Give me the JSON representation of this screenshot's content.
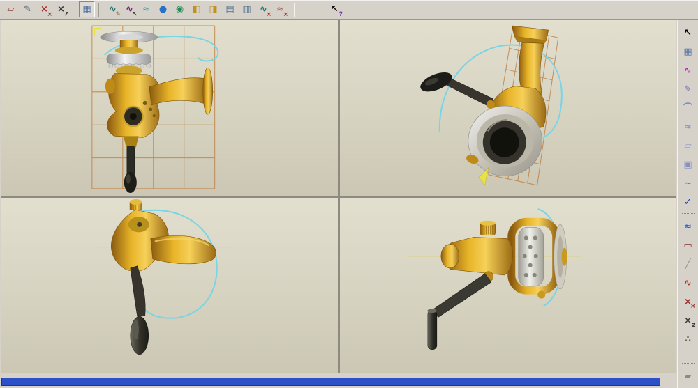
{
  "colors": {
    "toolbar_bg": "#d6d2ca",
    "viewport_top": "#e3dfcf",
    "viewport_bottom": "#cbc7b4",
    "grid_orange": "#bf7f3f",
    "style_curve_cyan": "#7ad4e4",
    "model_gold": "#e8b428",
    "statusbar_blue": "#2b50c8"
  },
  "top_toolbar": {
    "groups": [
      {
        "icons": [
          {
            "name": "datum-plane-sketch-icon",
            "glyph": "▱",
            "color": "#8a4838"
          },
          {
            "name": "sketch-line-icon",
            "glyph": "✎",
            "color": "#586878"
          },
          {
            "name": "datum-point-icon",
            "glyph": "×",
            "color": "#a03030",
            "badge": "×",
            "badgeColor": "#a03030"
          },
          {
            "name": "datum-axis-icon",
            "glyph": "×",
            "color": "#303030",
            "badge": "↗",
            "badgeColor": "#303030"
          }
        ]
      },
      {
        "icons": [
          {
            "name": "datum-display-toggle-icon",
            "glyph": "▦",
            "color": "#5070a0",
            "pressed": true
          }
        ]
      },
      {
        "icons": [
          {
            "name": "curve-through-points-icon",
            "glyph": "∿",
            "color": "#207878",
            "badge": "✎",
            "badgeColor": "#806040"
          },
          {
            "name": "modify-curve-icon",
            "glyph": "∿",
            "color": "#782078",
            "badge": "↖",
            "badgeColor": "#303030"
          },
          {
            "name": "smooth-curve-icon",
            "glyph": "≈",
            "color": "#28a0b8"
          },
          {
            "name": "shaded-view-icon",
            "glyph": "●",
            "color": "#2870c8"
          },
          {
            "name": "render-preview-icon",
            "glyph": "◉",
            "color": "#208850"
          },
          {
            "name": "surface-copy-icon",
            "glyph": "◧",
            "color": "#c09020"
          },
          {
            "name": "surface-merge-icon",
            "glyph": "◨",
            "color": "#c09020"
          },
          {
            "name": "measure-ruler-icon",
            "glyph": "▤",
            "color": "#507090"
          },
          {
            "name": "measure-grid-icon",
            "glyph": "▥",
            "color": "#507090"
          },
          {
            "name": "delete-curve-icon",
            "glyph": "∿",
            "color": "#207878",
            "badge": "×",
            "badgeColor": "#c02020"
          },
          {
            "name": "erase-analysis-icon",
            "glyph": "≈",
            "color": "#b04040",
            "badge": "×",
            "badgeColor": "#c02020"
          }
        ]
      },
      {
        "icons": [
          {
            "name": "context-help-icon",
            "glyph": "↖",
            "color": "#101010",
            "badge": "?",
            "badgeColor": "#7028a0"
          }
        ]
      }
    ]
  },
  "right_toolbar": {
    "items": [
      {
        "name": "select-arrow-icon",
        "glyph": "↖",
        "color": "#000000"
      },
      {
        "name": "datum-plane-icon",
        "glyph": "▦",
        "color": "#5878a8"
      },
      {
        "name": "style-curve-icon",
        "glyph": "∿",
        "color": "#b028b0"
      },
      {
        "name": "sketch-curve-icon",
        "glyph": "✎",
        "color": "#7868a8"
      },
      {
        "name": "arc-tool-icon",
        "glyph": "⌒",
        "color": "#7888c8"
      },
      {
        "name": "offset-curve-icon",
        "glyph": "≈",
        "color": "#8898d0"
      },
      {
        "name": "surface-sheet-icon",
        "glyph": "▱",
        "color": "#98a0d0"
      },
      {
        "name": "fold-surface-icon",
        "glyph": "▣",
        "color": "#8890c0"
      },
      {
        "name": "flow-curve-icon",
        "glyph": "∼",
        "color": "#6878b8"
      },
      {
        "name": "accept-check-icon",
        "glyph": "✓",
        "color": "#1830c0"
      },
      {
        "type": "separator"
      },
      {
        "name": "analysis-curve-icon",
        "glyph": "≈",
        "color": "#3068c0"
      },
      {
        "name": "boundary-rect-icon",
        "glyph": "▭",
        "color": "#883028"
      },
      {
        "name": "construction-line-icon",
        "glyph": "╱",
        "color": "#909080"
      },
      {
        "name": "deviation-curve-icon",
        "glyph": "∿",
        "color": "#b03028"
      },
      {
        "name": "datum-point-pair-icon",
        "glyph": "×",
        "color": "#a03030",
        "badge": "×",
        "badgeColor": "#a03030"
      },
      {
        "name": "axis-zx-icon",
        "glyph": "×",
        "color": "#404040",
        "badge": "z",
        "badgeColor": "#404040"
      },
      {
        "name": "snap-points-icon",
        "glyph": "∴",
        "color": "#806050"
      },
      {
        "type": "spacer"
      },
      {
        "type": "separator"
      },
      {
        "name": "measure-clip-icon",
        "glyph": "▰",
        "color": "#8a8a8a"
      }
    ]
  },
  "viewports": [
    {
      "name": "front-view"
    },
    {
      "name": "isometric-view"
    },
    {
      "name": "top-view"
    },
    {
      "name": "side-view"
    }
  ],
  "statusbar": {
    "progress_color": "#2b50c8"
  }
}
